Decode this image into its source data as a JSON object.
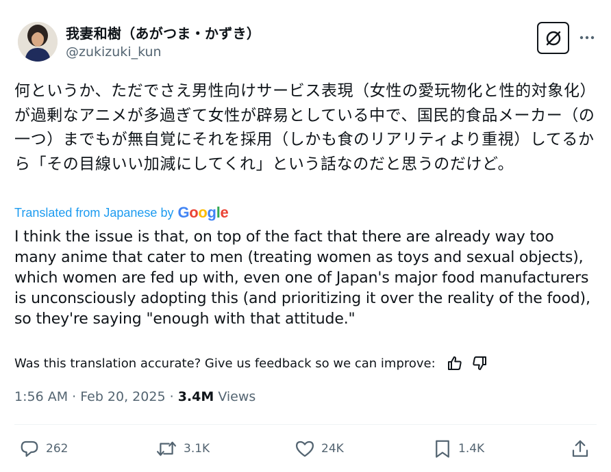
{
  "author": {
    "display_name": "我妻和樹（あがつま・かずき）",
    "handle": "@zukizuki_kun"
  },
  "tweet": {
    "original_text": "何というか、ただでさえ男性向けサービス表現（女性の愛玩物化と性的対象化）が過剰なアニメが多過ぎて女性が辟易としている中で、国民的食品メーカー（の一つ）までもが無自覚にそれを採用（しかも食のリアリティより重視）してるから「その目線いい加減にしてくれ」という話なのだと思うのだけど。",
    "translated_from_label": "Translated from Japanese by",
    "translation_provider": "Google",
    "translated_text": "I think the issue is that, on top of the fact that there are already way too many anime that cater to men (treating women as toys and sexual objects), which women are fed up with, even one of Japan's major food manufacturers is unconsciously adopting this (and prioritizing it over the reality of the food), so they're saying \"enough with that attitude.\"",
    "feedback_prompt": "Was this translation accurate? Give us feedback so we can improve:"
  },
  "meta": {
    "time": "1:56 AM",
    "sep1": "·",
    "date": "Feb 20, 2025",
    "sep2": "·",
    "views_count": "3.4M",
    "views_label": "Views"
  },
  "actions": {
    "replies": "262",
    "reposts": "3.1K",
    "likes": "24K",
    "bookmarks": "1.4K"
  },
  "icons": {
    "grok": "grok-icon",
    "more": "more-icon",
    "thumbs_up": "thumbs-up-icon",
    "thumbs_down": "thumbs-down-icon",
    "reply": "reply-icon",
    "repost": "repost-icon",
    "like": "heart-icon",
    "bookmark": "bookmark-icon",
    "share": "share-icon"
  },
  "colors": {
    "text": "#0f1419",
    "secondary": "#536471",
    "link": "#1d9bf0",
    "divider": "#eff3f4"
  }
}
